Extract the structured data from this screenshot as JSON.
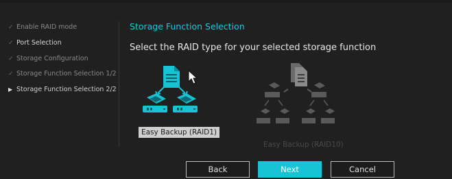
{
  "sidebar": {
    "steps": [
      {
        "label": "Enable RAID mode",
        "marker": "✓"
      },
      {
        "label": "Port Selection",
        "marker": "✓"
      },
      {
        "label": "Storage Configuration",
        "marker": "✓"
      },
      {
        "label": "Storage Function Selection 1/2",
        "marker": "✓"
      },
      {
        "label": "Storage Function Selection 2/2",
        "marker": "▶"
      }
    ],
    "current_index": 4
  },
  "main": {
    "heading": "Storage Function Selection",
    "subtitle": "Select the RAID type for your selected storage function",
    "options": [
      {
        "label": "Easy Backup (RAID1)",
        "state": "selected",
        "icon": "raid1-mirror-diagram-icon"
      },
      {
        "label": "Easy Backup (RAID10)",
        "state": "disabled",
        "icon": "raid10-mirror-stripe-diagram-icon"
      }
    ]
  },
  "buttons": {
    "back": "Back",
    "next": "Next",
    "cancel": "Cancel"
  },
  "colors": {
    "accent": "#19c3d6",
    "background": "#202020",
    "disabled": "#4a4a4a"
  }
}
